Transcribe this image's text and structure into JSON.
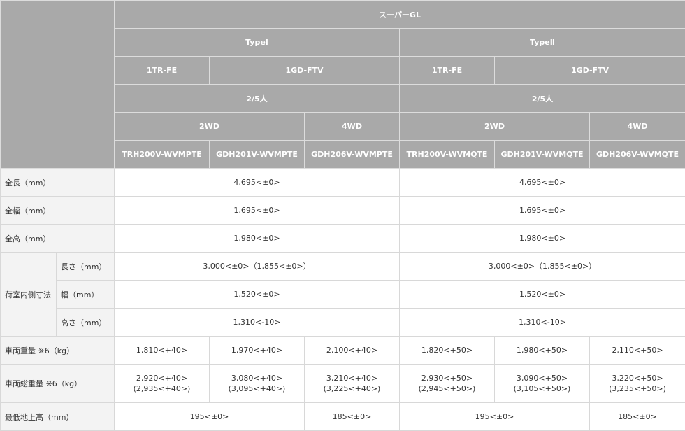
{
  "header": {
    "grade": "スーパーGL",
    "types": [
      "TypeⅠ",
      "TypeⅡ"
    ],
    "engines": [
      "1TR-FE",
      "1GD-FTV",
      "1TR-FE",
      "1GD-FTV"
    ],
    "capacity": [
      "2/5人",
      "2/5人"
    ],
    "drive": [
      "2WD",
      "4WD",
      "2WD",
      "4WD"
    ],
    "models": [
      "TRH200V-WVMPTE",
      "GDH201V-WVMPTE",
      "GDH206V-WVMPTE",
      "TRH200V-WVMQTE",
      "GDH201V-WVMQTE",
      "GDH206V-WVMQTE"
    ]
  },
  "rows": {
    "length": {
      "label": "全長（mm）",
      "type1": "4,695<±0>",
      "type2": "4,695<±0>"
    },
    "width": {
      "label": "全幅（mm）",
      "type1": "1,695<±0>",
      "type2": "1,695<±0>"
    },
    "height": {
      "label": "全高（mm）",
      "type1": "1,980<±0>",
      "type2": "1,980<±0>"
    },
    "cargo": {
      "group_label": "荷室内側寸法",
      "length": {
        "label": "長さ（mm）",
        "type1": "3,000<±0>（1,855<±0>）",
        "type2": "3,000<±0>（1,855<±0>）"
      },
      "width": {
        "label": "幅（mm）",
        "type1": "1,520<±0>",
        "type2": "1,520<±0>"
      },
      "height": {
        "label": "高さ（mm）",
        "type1": "1,310<-10>",
        "type2": "1,310<-10>"
      }
    },
    "weight": {
      "label": "車両重量 ※6（kg）",
      "values": [
        "1,810<+40>",
        "1,970<+40>",
        "2,100<+40>",
        "1,820<+50>",
        "1,980<+50>",
        "2,110<+50>"
      ]
    },
    "gross_weight": {
      "label": "車両総重量 ※6（kg）",
      "values": [
        [
          "2,920<+40>",
          "(2,935<+40>)"
        ],
        [
          "3,080<+40>",
          "(3,095<+40>)"
        ],
        [
          "3,210<+40>",
          "(3,225<+40>)"
        ],
        [
          "2,930<+50>",
          "(2,945<+50>)"
        ],
        [
          "3,090<+50>",
          "(3,105<+50>)"
        ],
        [
          "3,220<+50>",
          "(3,235<+50>)"
        ]
      ]
    },
    "ground_clearance": {
      "label": "最低地上高（mm）",
      "values": [
        "195<±0>",
        "185<±0>",
        "195<±0>",
        "185<±0>"
      ]
    }
  },
  "colors": {
    "header_bg": "#a9a9a9",
    "label_bg": "#f3f3f3",
    "border": "#d8d8d8"
  }
}
